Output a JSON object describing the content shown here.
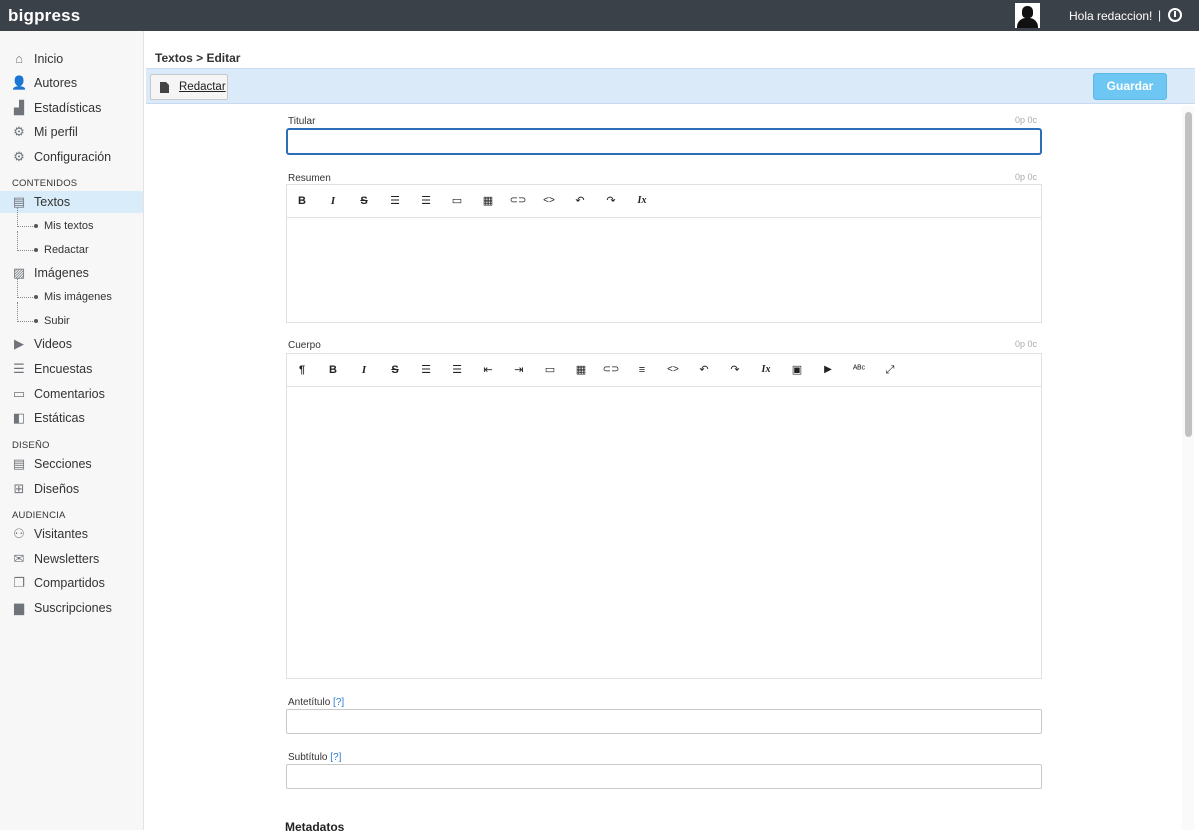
{
  "app": {
    "brand": "bigpress",
    "greeting": "Hola redaccion!",
    "separator": "|"
  },
  "sidebar": {
    "items": [
      {
        "label": "Inicio",
        "icon": "home-icon",
        "glyph": "⌂"
      },
      {
        "label": "Autores",
        "icon": "user-icon",
        "glyph": "👤"
      },
      {
        "label": "Estadísticas",
        "icon": "chart-icon",
        "glyph": "▟"
      },
      {
        "label": "Mi perfil",
        "icon": "gears-icon",
        "glyph": "⚙"
      },
      {
        "label": "Configuración",
        "icon": "gear-icon",
        "glyph": "⚙"
      }
    ],
    "sections": {
      "contenidos": "CONTENIDOS",
      "diseno": "DISEÑO",
      "audiencia": "AUDIENCIA"
    },
    "contenidos": [
      {
        "label": "Textos",
        "icon": "documents-icon",
        "glyph": "▤"
      },
      {
        "label": "Mis textos"
      },
      {
        "label": "Redactar"
      },
      {
        "label": "Imágenes",
        "icon": "image-icon",
        "glyph": "▨"
      },
      {
        "label": "Mis imágenes"
      },
      {
        "label": "Subir"
      },
      {
        "label": "Videos",
        "icon": "video-icon",
        "glyph": "▶"
      },
      {
        "label": "Encuestas",
        "icon": "poll-icon",
        "glyph": "☰"
      },
      {
        "label": "Comentarios",
        "icon": "comment-icon",
        "glyph": "▭"
      },
      {
        "label": "Estáticas",
        "icon": "page-icon",
        "glyph": "◧"
      }
    ],
    "diseno": [
      {
        "label": "Secciones",
        "icon": "list-icon",
        "glyph": "▤"
      },
      {
        "label": "Diseños",
        "icon": "grid-icon",
        "glyph": "⊞"
      }
    ],
    "audiencia": [
      {
        "label": "Visitantes",
        "icon": "users-icon",
        "glyph": "⚇"
      },
      {
        "label": "Newsletters",
        "icon": "newsletter-icon",
        "glyph": "✉"
      },
      {
        "label": "Compartidos",
        "icon": "share-icon",
        "glyph": "❐"
      },
      {
        "label": "Suscripciones",
        "icon": "briefcase-icon",
        "glyph": "▆"
      }
    ]
  },
  "main": {
    "breadcrumb": "Textos > Editar",
    "redactar_label": "Redactar",
    "guardar_label": "Guardar",
    "fields": {
      "titular": {
        "label": "Titular",
        "counter": "0p 0c",
        "value": ""
      },
      "resumen": {
        "label": "Resumen",
        "counter": "0p 0c"
      },
      "cuerpo": {
        "label": "Cuerpo",
        "counter": "0p 0c"
      },
      "antetitulo": {
        "label": "Antetítulo",
        "help": "[?]",
        "value": ""
      },
      "subtitulo": {
        "label": "Subtítulo",
        "help": "[?]",
        "value": ""
      }
    },
    "metadatos": "Metadatos",
    "toolbar_glyphs": {
      "paragraph": "¶",
      "bold": "B",
      "italic": "I",
      "strike": "S",
      "ul": "☰",
      "ol": "☰",
      "outdent": "⇤",
      "indent": "⇥",
      "embed": "▭",
      "table": "▦",
      "link": "⊂⊃",
      "align": "≡",
      "code": "<>",
      "undo": "↶",
      "redo": "↷",
      "clear": "Ix",
      "image": "▣",
      "video": "▶",
      "spell": "ᴬᴮᶜ",
      "fullscreen": "⤢"
    }
  }
}
